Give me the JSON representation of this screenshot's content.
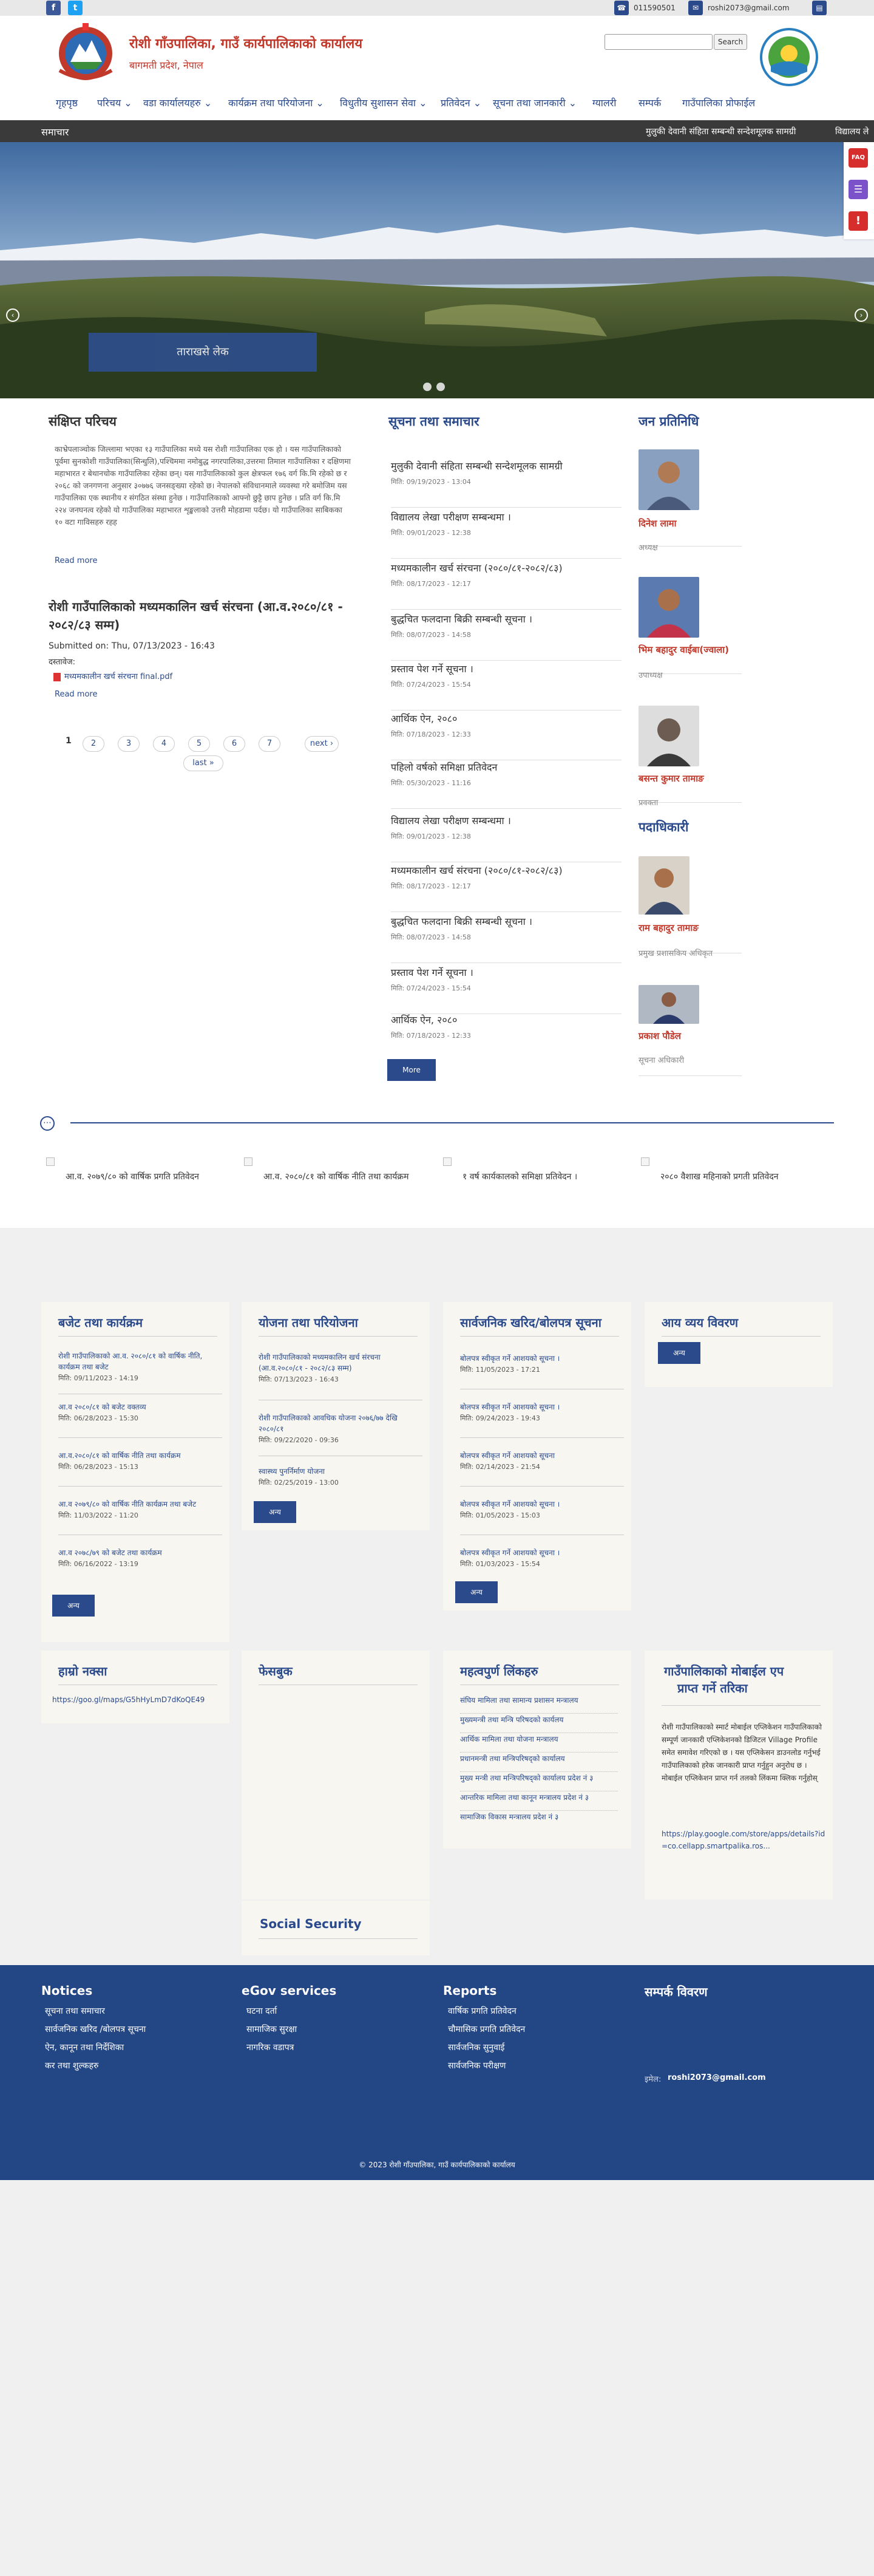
{
  "topbar": {
    "facebook_icon": "f",
    "twitter_icon": "t",
    "phone": "011590501",
    "email": "roshi2073@gmail.com"
  },
  "header": {
    "title": "रोशी गाँउपालिका, गाउँ कार्यपालिकाको कार्यालय",
    "subtitle": "बागमती प्रदेश, नेपाल",
    "search_button": "Search",
    "search_placeholder": ""
  },
  "nav": {
    "items": [
      {
        "label": "गृहपृष्ठ"
      },
      {
        "label": "परिचय ⌄"
      },
      {
        "label": "वडा कार्यालयहरु ⌄"
      },
      {
        "label": "कार्यक्रम तथा परियोजना ⌄"
      },
      {
        "label": "विधुतीय सुशासन सेवा ⌄"
      },
      {
        "label": "प्रतिवेदन ⌄"
      },
      {
        "label": "सूचना तथा जानकारी ⌄"
      },
      {
        "label": "ग्यालरी"
      },
      {
        "label": "सम्पर्क"
      },
      {
        "label": "गाउँपालिका प्रोफाईल"
      }
    ]
  },
  "ticker": {
    "label": "समाचार",
    "items": [
      "मुलुकी देवानी संहिता सम्बन्धी सन्देशमूलक सामग्री",
      "विद्यालय ले"
    ]
  },
  "hero": {
    "caption": "ताराखसे लेक",
    "prev": "‹",
    "next": "›"
  },
  "side_icons": {
    "faq": "FAQ",
    "chat": "☰",
    "alert": "!"
  },
  "intro": {
    "title": "संक्षिप्त परिचय",
    "text": "काभ्रेपलाञ्चोक जिल्लामा भएका १३ गाउँपालिका मध्ये यस रोशी गाउँपालिका एक हो । यस गाउँपालिकाको पूर्वमा सुनकोशी गाउँपालिका(सिन्धुलि),पश्चिममा नमोबुद्ध नगरपालिका,उत्तरमा तिमाल गाउँपालिका र दक्षिणमा महाभारत र बेथानचोक गाउँपालिका रहेका छन्। यस गाउँपालिकाको कुल क्षेत्रफल १७६ वर्ग कि.मि रहेको छ र २०६८ को जनगणना अनुसार ३०७७६ जनसङ्ख्या रहेको छ। नेपालको संविधानमाले व्यवस्था गरे बमोजिम यस गाउँपालिका एक स्थानीय र संगठित संस्था हुनेछ । गाउँपालिकाको आफ्नो छुट्टै छाप हुनेछ । प्रति वर्ग कि.मि २२४ जनघनत्व रहेको यो गाउँपालिका महाभारत शृङ्खलाको उत्तरी मोहडामा पर्दछ। यो गाउँपालिका साबिकका १० वटा गाविसहरु रहह",
    "read_more": "Read more"
  },
  "article": {
    "title": "रोशी गाउँपालिकाको मध्यमकालिन खर्च संरचना (आ.व.२०८०/८१ - २०८२/८३ सम्म)",
    "submitted": "Submitted on: Thu, 07/13/2023 - 16:43",
    "doc_label": "दस्तावेज:",
    "file": "मध्यमकालीन खर्च संरचना final.pdf",
    "read_more": "Read more"
  },
  "pager": {
    "current": "1",
    "pages": [
      "2",
      "3",
      "4",
      "5",
      "6",
      "7"
    ],
    "next": "next ›",
    "last": "last »"
  },
  "news": {
    "title": "सूचना तथा समाचार",
    "items": [
      {
        "title": "मुलुकी देवानी संहिता सम्बन्धी सन्देशमूलक सामग्री",
        "date": "मिति: 09/19/2023 - 13:04"
      },
      {
        "title": "विद्यालय लेखा परीक्षण सम्बन्धमा ।",
        "date": "मिति: 09/01/2023 - 12:38"
      },
      {
        "title": "मध्यमकालीन खर्च संरचना (२०८०/८१-२०८२/८३)",
        "date": "मिति: 08/17/2023 - 12:17"
      },
      {
        "title": "बुद्धचित फलदाना बिक्री सम्बन्धी सूचना ।",
        "date": "मिति: 08/07/2023 - 14:58"
      },
      {
        "title": "प्रस्ताव पेश गर्ने सूचना ।",
        "date": "मिति: 07/24/2023 - 15:54"
      },
      {
        "title": "आर्थिक ऐन, २०८०",
        "date": "मिति: 07/18/2023 - 12:33"
      },
      {
        "title": "पहिलो वर्षको समिक्षा प्रतिवेदन",
        "date": "मिति: 05/30/2023 - 11:16"
      },
      {
        "title": "विद्यालय लेखा परीक्षण सम्बन्धमा ।",
        "date": "मिति: 09/01/2023 - 12:38"
      },
      {
        "title": "मध्यमकालीन खर्च संरचना (२०८०/८१-२०८२/८३)",
        "date": "मिति: 08/17/2023 - 12:17"
      },
      {
        "title": "बुद्धचित फलदाना बिक्री सम्बन्धी सूचना ।",
        "date": "मिति: 08/07/2023 - 14:58"
      },
      {
        "title": "प्रस्ताव पेश गर्ने सूचना ।",
        "date": "मिति: 07/24/2023 - 15:54"
      },
      {
        "title": "आर्थिक ऐन, २०८०",
        "date": "मिति: 07/18/2023 - 12:33"
      }
    ],
    "more": "More"
  },
  "representatives": {
    "title": "जन प्रतिनिधि",
    "people": [
      {
        "name": "दिनेश लामा",
        "role": "अध्यक्ष"
      },
      {
        "name": "भिम बहादुर वाईबा(ज्वाला)",
        "role": "उपाध्यक्ष"
      },
      {
        "name": "बसन्त कुमार तामाङ",
        "role": "प्रवक्ता"
      }
    ]
  },
  "officials": {
    "title": "पदाधिकारी",
    "people": [
      {
        "name": "राम बहादुर तामाङ",
        "role": "प्रमुख प्रशासकिय अधिकृत"
      },
      {
        "name": "प्रकाश पौडेल",
        "role": "सूचना अधिकारी"
      }
    ]
  },
  "reports": {
    "items": [
      "आ.व. २०७९/८० को वार्षिक प्रगति प्रतिवेदन",
      "आ.व. २०८०/८१ को वार्षिक नीति तथा कार्यक्रम",
      "१ वर्ष कार्यकालको समिक्षा प्रतिवेदन ।",
      "२०८० वैशाख महिनाको प्रगती प्रतिवेदन"
    ]
  },
  "budget": {
    "title": "बजेट तथा कार्यक्रम",
    "items": [
      {
        "text": "रोशी गाउँपालिकाको आ.व. २०८०/८१ को वार्षिक नीति, कार्यक्रम तथा बजेट",
        "date": "मिति: 09/11/2023 - 14:19"
      },
      {
        "text": "आ.व २०८०/८१ को बजेट वक्तव्य",
        "date": "मिति: 06/28/2023 - 15:30"
      },
      {
        "text": "आ.व.२०८०/८१ को वार्षिक नीति तथा कार्यक्रम",
        "date": "मिति: 06/28/2023 - 15:13"
      },
      {
        "text": "आ.व २०७९/८० को वार्षिक नीति कार्यक्रम तथा बजेट",
        "date": "मिति: 11/03/2022 - 11:20"
      },
      {
        "text": "आ.व २०७८/७९ को बजेट तथा कार्यक्रम",
        "date": "मिति: 06/16/2022 - 13:19"
      }
    ],
    "more": "अन्य"
  },
  "projects": {
    "title": "योजना तथा परियोजना",
    "items": [
      {
        "text": "रोशी गाउँपालिकाको मध्यमकालिन खर्च संरचना (आ.व.२०८०/८१ - २०८२/८३ सम्म)",
        "date": "मिति: 07/13/2023 - 16:43"
      },
      {
        "text": "रोशी गाउँपालिकाको आवधिक योजना २०७६/७७ देखि २०८०/८१",
        "date": "मिति: 09/22/2020 - 09:36"
      },
      {
        "text": "स्वास्थ्य पुनर्निर्माण योजना",
        "date": "मिति: 02/25/2019 - 13:00"
      }
    ],
    "more": "अन्य"
  },
  "procurement": {
    "title": "सार्वजनिक खरिद/बोलपत्र सूचना",
    "items": [
      {
        "text": "बोलपत्र स्वीकृत गर्ने आशयको सूचना ।",
        "date": "मिति: 11/05/2023 - 17:21"
      },
      {
        "text": "बोलपत्र स्वीकृत गर्ने आशयको सूचना ।",
        "date": "मिति: 09/24/2023 - 19:43"
      },
      {
        "text": "बोलपत्र स्वीकृत गर्ने आशयको सूचना",
        "date": "मिति: 02/14/2023 - 21:54"
      },
      {
        "text": "बोलपत्र स्वीकृत गर्ने आशयको सूचना ।",
        "date": "मिति: 01/05/2023 - 15:03"
      },
      {
        "text": "बोलपत्र स्वीकृत गर्ने आशयको सूचना ।",
        "date": "मिति: 01/03/2023 - 15:54"
      }
    ],
    "more": "अन्य"
  },
  "income": {
    "title": "आय व्यय विवरण",
    "more": "अन्य"
  },
  "map": {
    "title": "हाम्रो नक्सा",
    "link": "https://goo.gl/maps/G5hHyLmD7dKoQE49"
  },
  "facebook": {
    "title": "फेसबुक"
  },
  "quick_links": {
    "title": "महत्वपुर्ण लिंकहरु",
    "items": [
      "संघिय मामिला तथा सामान्य प्रशासन मन्त्रालय",
      "मुख्यमन्त्री तथा मन्त्रि परिषदको कार्यलय",
      "आर्थिक मामिला तथा योजना मन्त्रालय",
      "प्रधानमन्त्री तथा मन्त्रिपरिषद्को कार्यालय",
      "मुख्य मन्त्री तथा मन्त्रिपरिषद्को कार्यालय प्रदेश नं ३",
      "आन्तरिक मामिला तथा कानून मन्त्रालय प्रदेश नं ३",
      "सामाजिक विकास मन्त्रालय प्रदेश नं ३"
    ]
  },
  "mobile_app": {
    "title_line1": "गाउँपालिकाको मोबाईल एप",
    "title_line2": "प्राप्त गर्ने तरिका",
    "description": "रोशी गाउँपालिकाको स्मार्ट मोबाईल एप्लिकेशन गाउँपालिकाको सम्पूर्ण जानकारी एप्लिकेशनको डिजिटल Village Profile समेत समावेश गरिएको छ । यस एप्लिकेसन डाउनलोड गर्नुभई गाउँपालिकाको हरेक जानकारी प्राप्त गर्नुहुन अनुरोध छ । मोबाईल एप्लिकेशन प्राप्त गर्न तलको लिंकमा क्लिक गर्नुहोस्",
    "link": "https://play.google.com/store/apps/details?id=co.cellapp.smartpalika.ros..."
  },
  "social_security": {
    "title": "Social Security"
  },
  "footer": {
    "notices": {
      "title": "Notices",
      "items": [
        "सूचना तथा समाचार",
        "सार्वजनिक खरिद /बोलपत्र सूचना",
        "ऐन, कानून तथा निर्देशिका",
        "कर तथा शुल्कहरु"
      ]
    },
    "egov": {
      "title": "eGov services",
      "items": [
        "घटना दर्ता",
        "सामाजिक सुरक्षा",
        "नागरिक वडापत्र"
      ]
    },
    "reports": {
      "title": "Reports",
      "items": [
        "वार्षिक प्रगति प्रतिवेदन",
        "चौमासिक प्रगति प्रतिवेदन",
        "सार्वजनिक सुनुवाई",
        "सार्वजनिक परीक्षण"
      ]
    },
    "contact": {
      "title": "सम्पर्क विवरण",
      "email_label": "इमेल:",
      "email": "roshi2073@gmail.com"
    },
    "copyright": "© 2023 रोशी गाँउपालिका, गाउँ कार्यपालिकाको कार्यालय"
  },
  "colors": {
    "brand_blue": "#2a4a8c",
    "brand_red": "#c0392b",
    "footer_blue": "#234685",
    "ticker_bg": "#3a3a3a"
  }
}
